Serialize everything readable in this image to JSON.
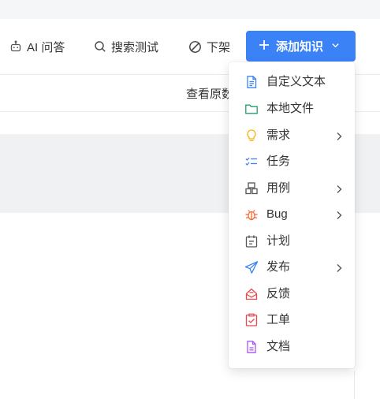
{
  "toolbar": {
    "ai_label": "AI 问答",
    "search_test_label": "搜索测试",
    "unpublish_label": "下架",
    "add_knowledge_label": "添加知识"
  },
  "table": {
    "view_original_header": "查看原数"
  },
  "menu": {
    "items": [
      {
        "label": "自定义文本",
        "icon": "document-icon",
        "color": "#3b82f6",
        "submenu": false
      },
      {
        "label": "本地文件",
        "icon": "folder-icon",
        "color": "#22a06b",
        "submenu": false
      },
      {
        "label": "需求",
        "icon": "lightbulb-icon",
        "color": "#f5b400",
        "submenu": true
      },
      {
        "label": "任务",
        "icon": "task-list-icon",
        "color": "#3b82f6",
        "submenu": false
      },
      {
        "label": "用例",
        "icon": "testcase-icon",
        "color": "#555555",
        "submenu": true
      },
      {
        "label": "Bug",
        "icon": "bug-icon",
        "color": "#f26b3a",
        "submenu": true
      },
      {
        "label": "计划",
        "icon": "calendar-plan-icon",
        "color": "#555555",
        "submenu": false
      },
      {
        "label": "发布",
        "icon": "send-icon",
        "color": "#3b82f6",
        "submenu": true
      },
      {
        "label": "反馈",
        "icon": "feedback-icon",
        "color": "#e5484d",
        "submenu": false
      },
      {
        "label": "工单",
        "icon": "ticket-icon",
        "color": "#e5484d",
        "submenu": false
      },
      {
        "label": "文档",
        "icon": "doc-file-icon",
        "color": "#a855f7",
        "submenu": false
      }
    ]
  }
}
